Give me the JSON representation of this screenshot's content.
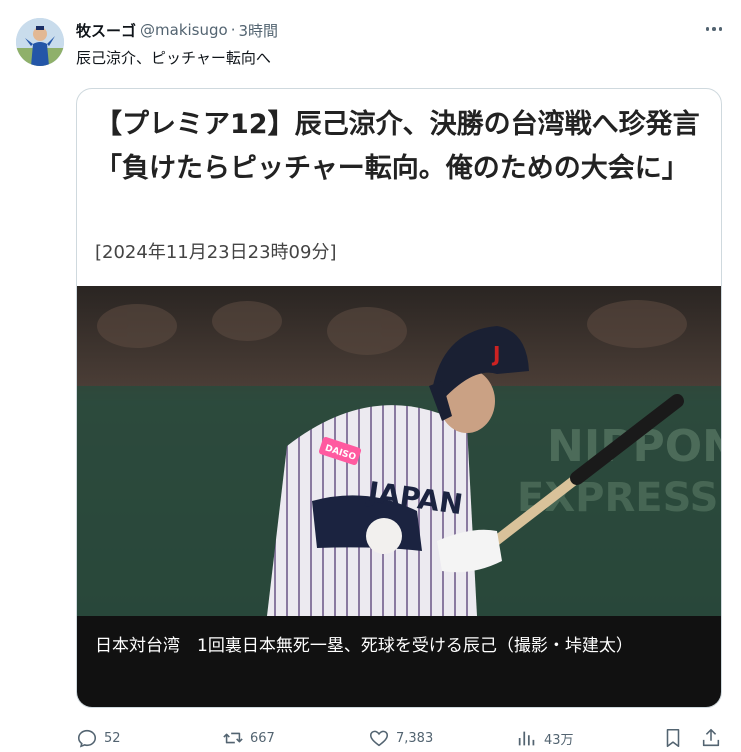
{
  "tweet": {
    "display_name": "牧スーゴ",
    "handle": "@makisugo",
    "separator": "·",
    "time": "3時間",
    "text": "辰己涼介、ピッチャー転向へ"
  },
  "card": {
    "headline": "【プレミア12】辰己涼介、決勝の台湾戦へ珍発言「負けたらピッチャー転向。俺のための大会に」",
    "date": "[2024年11月23日23時09分]",
    "photo_jersey_text": "JAPAN",
    "photo_patch_text": "DAISO",
    "caption": "日本対台湾　1回裏日本無死一塁、死球を受ける辰己（撮影・垰建太）"
  },
  "actions": {
    "replies": "52",
    "reposts": "667",
    "likes": "7,383",
    "views": "43万"
  },
  "icons": {
    "more": "more-icon",
    "reply": "reply-icon",
    "repost": "repost-icon",
    "like": "heart-icon",
    "views": "views-icon",
    "bookmark": "bookmark-icon",
    "share": "share-icon"
  },
  "colors": {
    "text": "#0f1419",
    "secondary": "#536471",
    "border": "#cfd9de",
    "caption_bg": "#111111"
  }
}
